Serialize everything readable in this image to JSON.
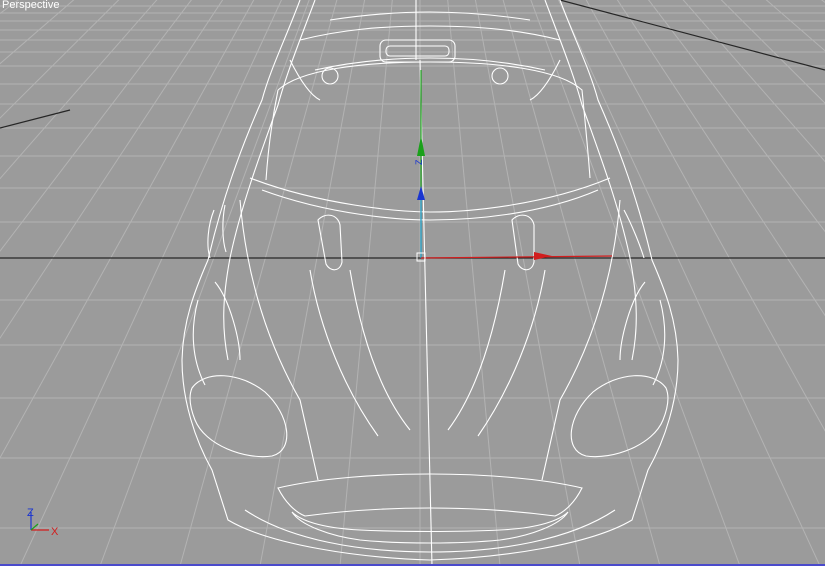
{
  "viewport": {
    "label": "Perspective",
    "background_color": "#9b9b9b",
    "grid_color": "#b3b3b3",
    "home_grid_color": "#262626",
    "wireframe_color": "#ffffff"
  },
  "gizmo": {
    "axes": [
      {
        "id": "x",
        "label": "",
        "color": "#d21e1e"
      },
      {
        "id": "y",
        "label": "",
        "color": "#1aa11a"
      },
      {
        "id": "z",
        "label": "Z",
        "color": "#1a35d0"
      }
    ]
  },
  "axis_tripod": {
    "x_label": "X",
    "z_label": "Z",
    "x_color": "#d21e1e",
    "z_color": "#1a35d0",
    "y_color": "#1aa11a"
  }
}
